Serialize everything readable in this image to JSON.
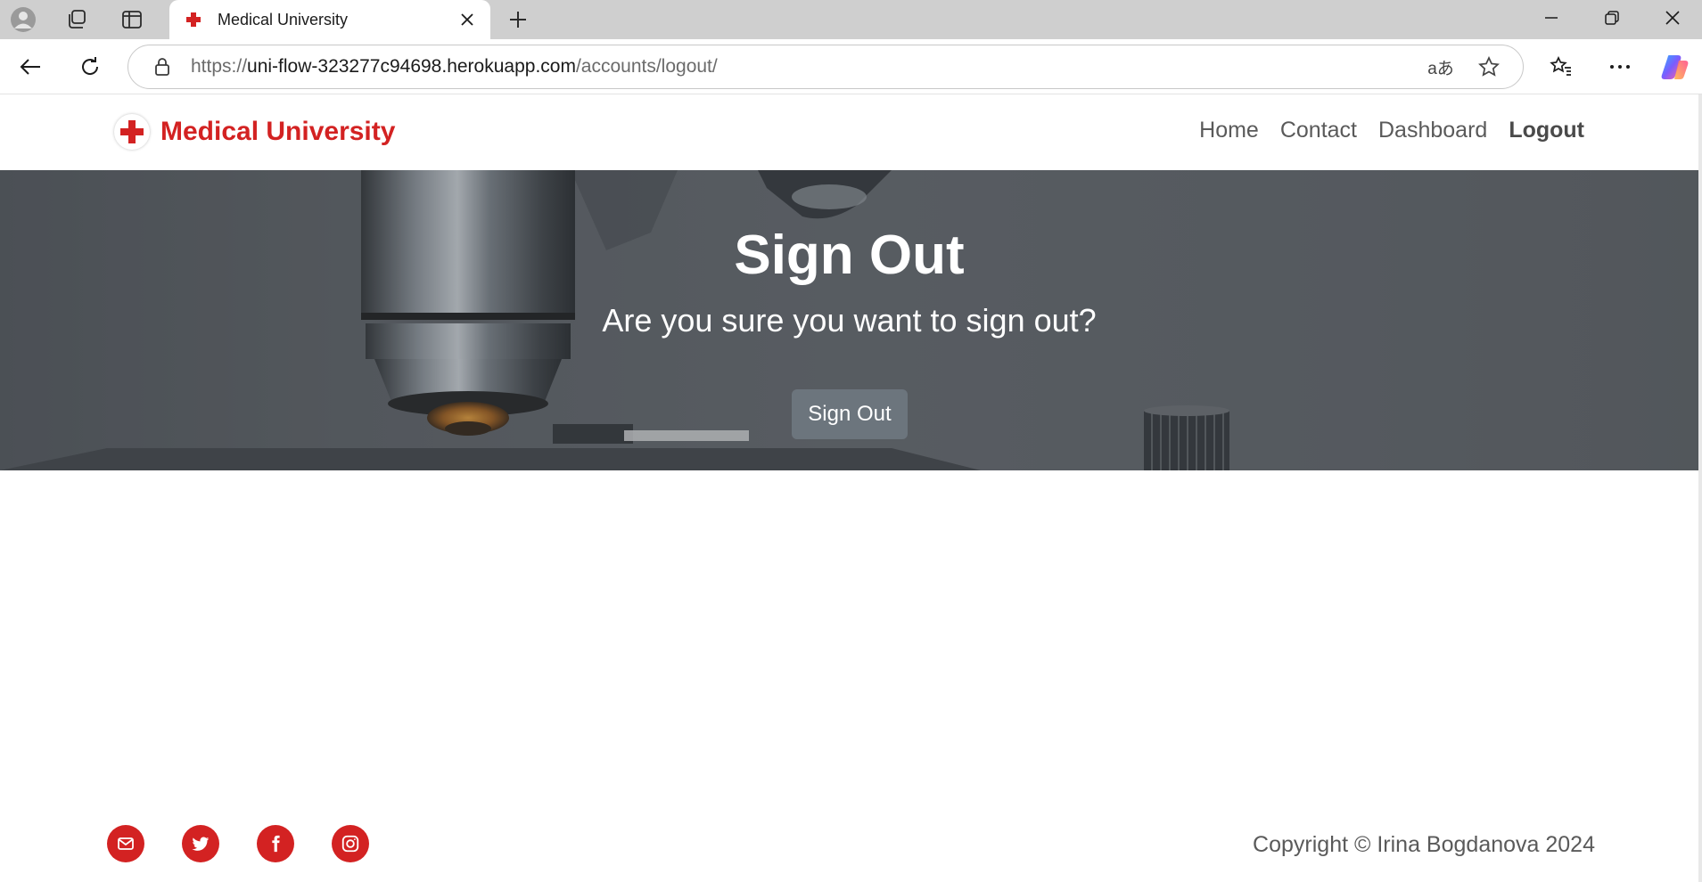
{
  "browser": {
    "tab_title": "Medical University",
    "url_prefix": "https://",
    "url_host": "uni-flow-323277c94698.herokuapp.com",
    "url_path": "/accounts/logout/",
    "read_aloud_glyph": "aあ"
  },
  "site": {
    "brand_name": "Medical University",
    "brand_color": "#d32222",
    "nav": [
      {
        "label": "Home"
      },
      {
        "label": "Contact"
      },
      {
        "label": "Dashboard"
      },
      {
        "label": "Logout"
      }
    ]
  },
  "hero": {
    "title": "Sign Out",
    "subtitle": "Are you sure you want to sign out?",
    "button_label": "Sign Out",
    "button_color": "#6c757d"
  },
  "footer": {
    "social_icons": [
      "email-icon",
      "twitter-icon",
      "facebook-icon",
      "instagram-icon"
    ],
    "copyright": "Copyright © Irina Bogdanova 2024"
  }
}
